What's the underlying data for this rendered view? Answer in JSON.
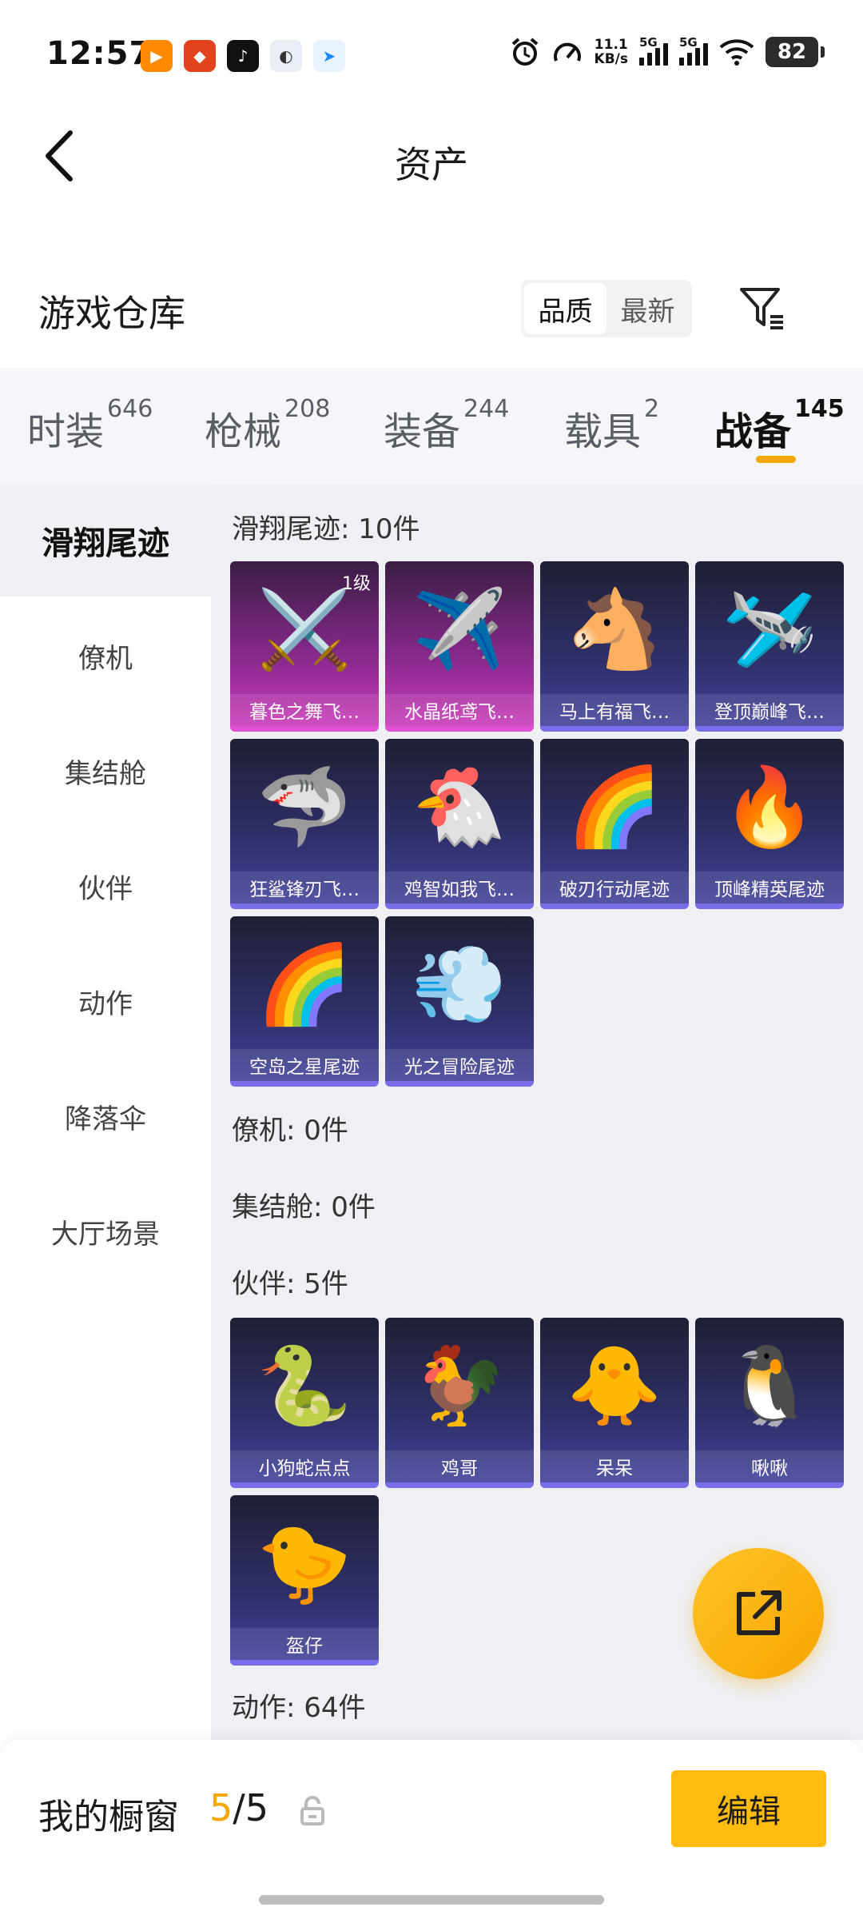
{
  "status_bar": {
    "time": "12:57",
    "net_speed_top": "11.1",
    "net_speed_unit": "KB/s",
    "signal1": "5G",
    "signal2": "5G",
    "battery": "82",
    "notif_icons": [
      "video-app-icon",
      "game-app-icon",
      "tiktok-icon",
      "app-icon",
      "telegram-icon"
    ]
  },
  "header": {
    "title": "资产",
    "back_icon": "chevron-left-icon"
  },
  "section": {
    "title": "游戏仓库",
    "sort_options": [
      "品质",
      "最新"
    ],
    "sort_selected": "品质",
    "filter_icon": "filter-icon"
  },
  "tabs": [
    {
      "label": "时装",
      "count": "646",
      "active": false
    },
    {
      "label": "枪械",
      "count": "208",
      "active": false
    },
    {
      "label": "装备",
      "count": "244",
      "active": false
    },
    {
      "label": "载具",
      "count": "2",
      "active": false
    },
    {
      "label": "战备",
      "count": "145",
      "active": true
    }
  ],
  "sidebar": {
    "items": [
      {
        "label": "滑翔尾迹",
        "active": true
      },
      {
        "label": "僚机",
        "active": false
      },
      {
        "label": "集结舱",
        "active": false
      },
      {
        "label": "伙伴",
        "active": false
      },
      {
        "label": "动作",
        "active": false
      },
      {
        "label": "降落伞",
        "active": false
      },
      {
        "label": "大厅场景",
        "active": false
      }
    ]
  },
  "groups": {
    "glide": {
      "label": "滑翔尾迹: 10件",
      "items": [
        {
          "name": "暮色之舞飞…",
          "level": "1级",
          "rarity": "purple",
          "art": "⚔️"
        },
        {
          "name": "水晶纸鸢飞…",
          "rarity": "purple",
          "art": "✈️"
        },
        {
          "name": "马上有福飞…",
          "rarity": "blue",
          "art": "🐴"
        },
        {
          "name": "登顶巅峰飞…",
          "rarity": "blue",
          "art": "🛩️"
        },
        {
          "name": "狂鲨锋刃飞…",
          "rarity": "blue",
          "art": "🦈"
        },
        {
          "name": "鸡智如我飞…",
          "rarity": "blue",
          "art": "🐔"
        },
        {
          "name": "破刃行动尾迹",
          "rarity": "blue",
          "art": "🌈"
        },
        {
          "name": "顶峰精英尾迹",
          "rarity": "blue",
          "art": "🔥"
        },
        {
          "name": "空岛之星尾迹",
          "rarity": "blue",
          "art": "🌈"
        },
        {
          "name": "光之冒险尾迹",
          "rarity": "blue",
          "art": "💨"
        }
      ]
    },
    "wingman": {
      "label": "僚机: 0件"
    },
    "pod": {
      "label": "集结舱: 0件"
    },
    "companion": {
      "label": "伙伴: 5件",
      "items": [
        {
          "name": "小狗蛇点点",
          "rarity": "blue",
          "art": "🐍"
        },
        {
          "name": "鸡哥",
          "rarity": "blue",
          "art": "🐓"
        },
        {
          "name": "呆呆",
          "rarity": "blue",
          "art": "🐥"
        },
        {
          "name": "啾啾",
          "rarity": "blue",
          "art": "🐧"
        },
        {
          "name": "盔仔",
          "rarity": "blue",
          "art": "🐤"
        }
      ]
    },
    "emote": {
      "label": "动作: 64件"
    }
  },
  "fab": {
    "icon": "share-external-icon"
  },
  "bottom_bar": {
    "showcase_label": "我的橱窗",
    "showcase_current": "5",
    "showcase_total": "/5",
    "lock_icon": "lock-icon",
    "edit_label": "编辑"
  }
}
